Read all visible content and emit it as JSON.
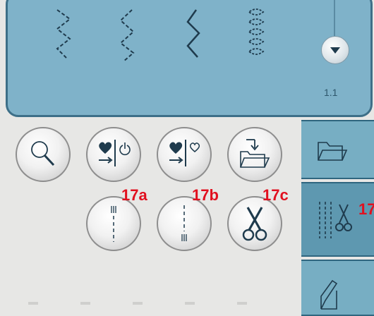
{
  "stitch_info": {
    "number": "1.1"
  },
  "side_tabs": [
    {
      "name": "folder",
      "icon": "folder-icon"
    },
    {
      "name": "stitch-cut",
      "icon": "stitch-scissors-icon"
    },
    {
      "name": "edit",
      "icon": "pencil-icon"
    }
  ],
  "buttons": [
    {
      "id": "zoom",
      "icon": "magnifier-icon"
    },
    {
      "id": "save-heart-power",
      "icon": "heart-arrow-power-icon"
    },
    {
      "id": "save-heart-outline",
      "icon": "heart-arrow-heart-icon"
    },
    {
      "id": "load-folder",
      "icon": "folder-arrow-icon"
    },
    {
      "id": "stitch-start",
      "icon": "stitch-line-top-icon"
    },
    {
      "id": "stitch-end",
      "icon": "stitch-line-bottom-icon"
    },
    {
      "id": "thread-cut",
      "icon": "scissors-icon"
    }
  ],
  "callouts": {
    "a": "17a",
    "b": "17b",
    "c": "17c",
    "d": "17"
  },
  "colors": {
    "panel": "#7fb2c9",
    "panel_border": "#3d6f88",
    "callout": "#e1101f",
    "icon": "#1f3b4d"
  }
}
